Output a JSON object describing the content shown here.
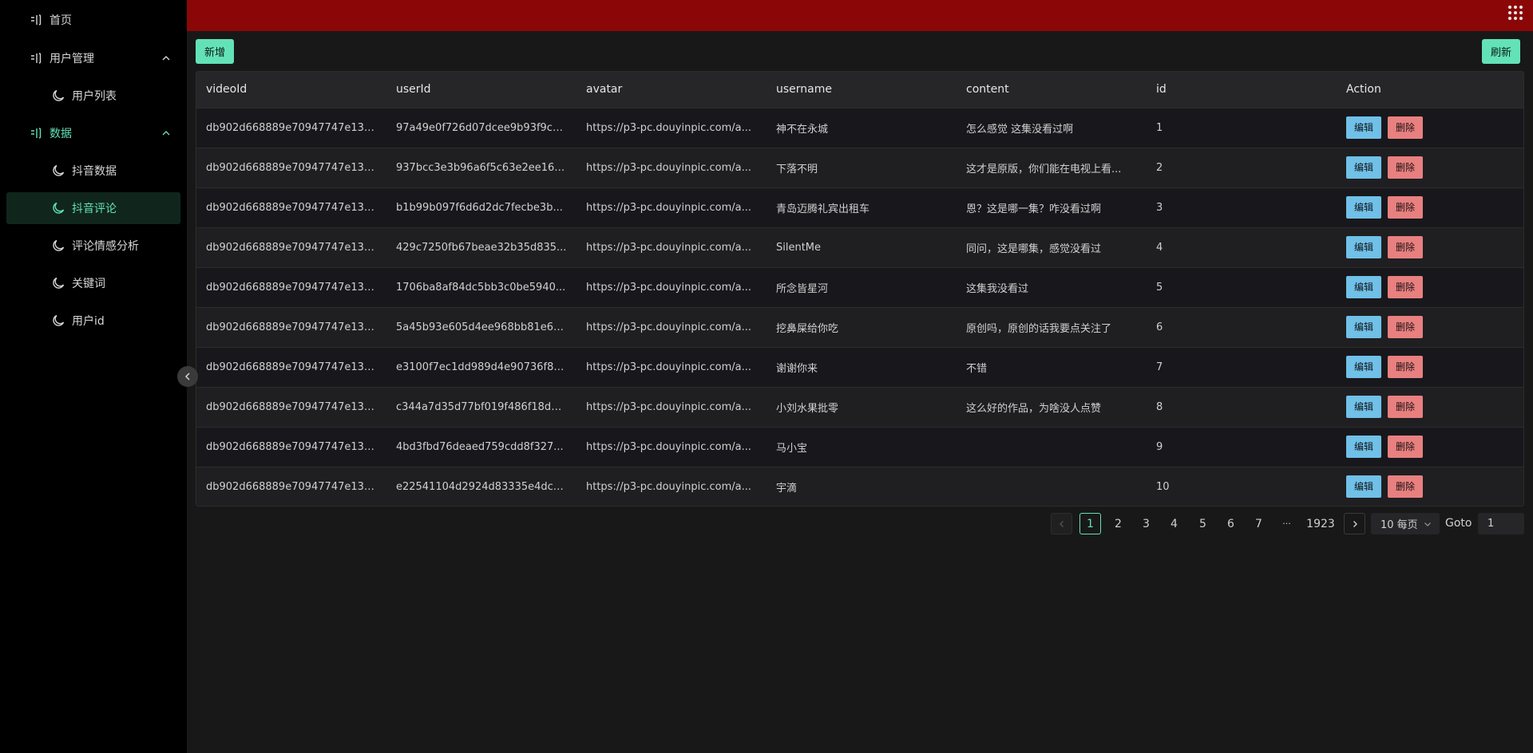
{
  "sidebar": {
    "items": [
      {
        "label": "首页",
        "icon": "book-icon"
      },
      {
        "label": "用户管理",
        "icon": "book-icon"
      },
      {
        "label": "用户列表",
        "icon": "moon-icon"
      },
      {
        "label": "数据",
        "icon": "book-icon"
      },
      {
        "label": "抖音数据",
        "icon": "moon-icon"
      },
      {
        "label": "抖音评论",
        "icon": "moon-icon"
      },
      {
        "label": "评论情感分析",
        "icon": "moon-icon"
      },
      {
        "label": "关键词",
        "icon": "moon-icon"
      },
      {
        "label": "用户id",
        "icon": "moon-icon"
      }
    ]
  },
  "toolbar": {
    "add_label": "新增",
    "refresh_label": "刷新"
  },
  "table": {
    "headers": [
      "videoId",
      "userId",
      "avatar",
      "username",
      "content",
      "id",
      "Action"
    ],
    "rows": [
      [
        "db902d668889e70947747e135...",
        "97a49e0f726d07dcee9b93f9c7...",
        "https://p3-pc.douyinpic.com/a...",
        "神不在永城",
        "怎么感觉 这集没看过啊",
        "1"
      ],
      [
        "db902d668889e70947747e135...",
        "937bcc3e3b96a6f5c63e2ee16a...",
        "https://p3-pc.douyinpic.com/a...",
        "下落不明",
        "这才是原版，你们能在电视上看...",
        "2"
      ],
      [
        "db902d668889e70947747e135...",
        "b1b99b097f6d6d2dc7fecbe3b...",
        "https://p3-pc.douyinpic.com/a...",
        "青岛迈腾礼宾出租车",
        "恩？这是哪一集？咋没看过啊",
        "3"
      ],
      [
        "db902d668889e70947747e135...",
        "429c7250fb67beae32b35d835...",
        "https://p3-pc.douyinpic.com/a...",
        "SilentMe",
        "同问，这是哪集，感觉没看过",
        "4"
      ],
      [
        "db902d668889e70947747e135...",
        "1706ba8af84dc5bb3c0be5940...",
        "https://p3-pc.douyinpic.com/a...",
        "所念皆星河",
        "这集我没看过",
        "5"
      ],
      [
        "db902d668889e70947747e135...",
        "5a45b93e605d4ee968bb81e6c...",
        "https://p3-pc.douyinpic.com/a...",
        "挖鼻屎给你吃",
        "原创吗，原创的话我要点关注了",
        "6"
      ],
      [
        "db902d668889e70947747e135...",
        "e3100f7ec1dd989d4e90736f88...",
        "https://p3-pc.douyinpic.com/a...",
        "谢谢你来",
        "不错",
        "7"
      ],
      [
        "db902d668889e70947747e135...",
        "c344a7d35d77bf019f486f18d6...",
        "https://p3-pc.douyinpic.com/a...",
        "小刘水果批零",
        "这么好的作品，为啥没人点赞",
        "8"
      ],
      [
        "db902d668889e70947747e135...",
        "4bd3fbd76deaed759cdd8f327...",
        "https://p3-pc.douyinpic.com/a...",
        "马小宝",
        "",
        "9"
      ],
      [
        "db902d668889e70947747e135...",
        "e22541104d2924d83335e4dc2...",
        "https://p3-pc.douyinpic.com/a...",
        "宇滴",
        "",
        "10"
      ]
    ],
    "edit_label": "编辑",
    "delete_label": "删除"
  },
  "pagination": {
    "pages": [
      "1",
      "2",
      "3",
      "4",
      "5",
      "6",
      "7",
      "···",
      "1923"
    ],
    "current": "1",
    "page_size_label": "10 每页",
    "goto_label": "Goto",
    "goto_value": "1"
  },
  "colors": {
    "accent": "#63e2b7",
    "topbar": "#8b0707",
    "edit": "#70c0e8",
    "delete": "#e88080"
  }
}
